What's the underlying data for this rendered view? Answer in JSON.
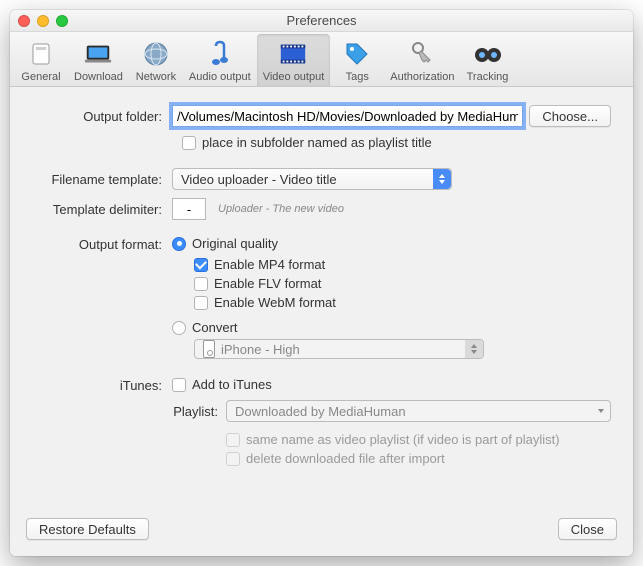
{
  "window": {
    "title": "Preferences"
  },
  "toolbar": {
    "items": [
      {
        "label": "General"
      },
      {
        "label": "Download"
      },
      {
        "label": "Network"
      },
      {
        "label": "Audio output"
      },
      {
        "label": "Video output"
      },
      {
        "label": "Tags"
      },
      {
        "label": "Authorization"
      },
      {
        "label": "Tracking"
      }
    ]
  },
  "form": {
    "outputFolder": {
      "label": "Output folder:",
      "value": "/Volumes/Macintosh HD/Movies/Downloaded by MediaHuman",
      "choose": "Choose...",
      "subfolderCheckbox": "place in subfolder named as playlist title"
    },
    "filenameTemplate": {
      "label": "Filename template:",
      "value": "Video uploader - Video title"
    },
    "templateDelimiter": {
      "label": "Template delimiter:",
      "value": "-",
      "hint": "Uploader - The new video"
    },
    "outputFormat": {
      "label": "Output format:",
      "original": "Original quality",
      "enableMp4": "Enable MP4 format",
      "enableFlv": "Enable FLV format",
      "enableWebm": "Enable WebM format",
      "convert": "Convert",
      "convertPreset": "iPhone - High"
    },
    "itunes": {
      "label": "iTunes:",
      "addToItunes": "Add to iTunes",
      "playlistLabel": "Playlist:",
      "playlistValue": "Downloaded by MediaHuman",
      "sameName": "same name as video playlist (if video is part of playlist)",
      "deleteAfter": "delete downloaded file after import"
    }
  },
  "footer": {
    "restore": "Restore Defaults",
    "close": "Close"
  }
}
